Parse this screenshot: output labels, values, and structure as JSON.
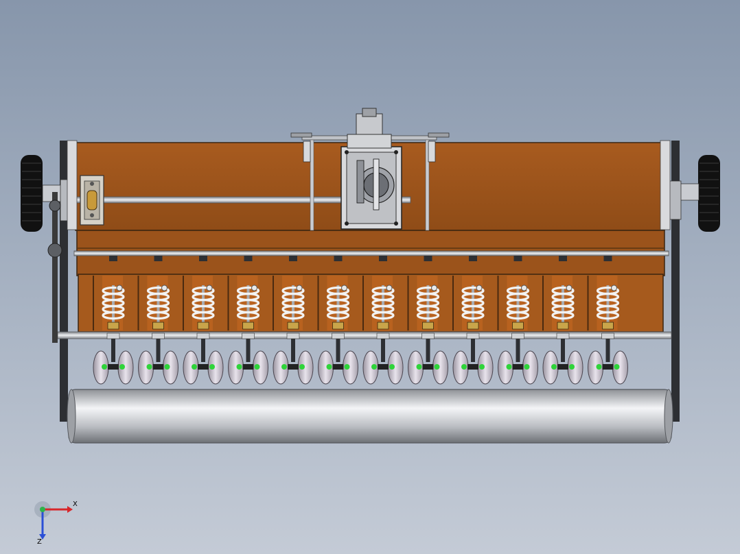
{
  "viewport": {
    "background_top": "#8796ab",
    "background_bottom": "#c4cbd6"
  },
  "model": {
    "hopper_color": "#a0561d",
    "hopper_edge": "#3a2410",
    "metal_color": "#c9ccd1",
    "dark_metal": "#2d2f33",
    "spring_color": "#f2f2f2",
    "seed_tube_color": "#2fd43a",
    "disc_color": "#d6d0da",
    "tire_color": "#111111",
    "roller_color": "#d9dbde",
    "coulter_count": 12,
    "icons": [
      "gearbox-icon",
      "wheel-icon",
      "bearing-icon",
      "spring-icon",
      "disc-opener-icon",
      "roller-icon"
    ]
  },
  "triad": {
    "x_label": "X",
    "z_label": "Z",
    "x_color": "#d8262a",
    "y_color": "#2fb34a",
    "z_color": "#2a4fd6"
  }
}
